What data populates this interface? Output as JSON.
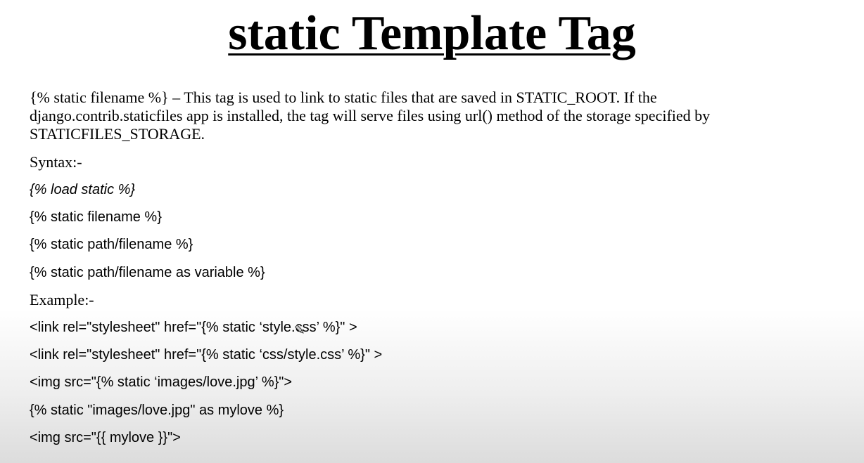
{
  "title": "static Template Tag",
  "description": {
    "line1": "{% static filename %} – This tag is used to link to static files that are saved in STATIC_ROOT. If the",
    "line2": "django.contrib.staticfiles app is installed, the tag will serve files using url() method of the storage specified by",
    "line3": "STATICFILES_STORAGE."
  },
  "syntax": {
    "heading": "Syntax:-",
    "lines": [
      "{% load static %}",
      "{% static filename %}",
      "{% static path/filename %}",
      "{% static path/filename as variable %}"
    ]
  },
  "example": {
    "heading": "Example:-",
    "lines": [
      "<link rel=\"stylesheet\" href=\"{% static ‘style.css’ %}\" >",
      "<link rel=\"stylesheet\" href=\"{% static ‘css/style.css’ %}\" >",
      "<img src=\"{% static ‘images/love.jpg’ %}\">",
      "{% static \"images/love.jpg\" as mylove %}",
      "<img src=\"{{ mylove }}\">"
    ]
  }
}
